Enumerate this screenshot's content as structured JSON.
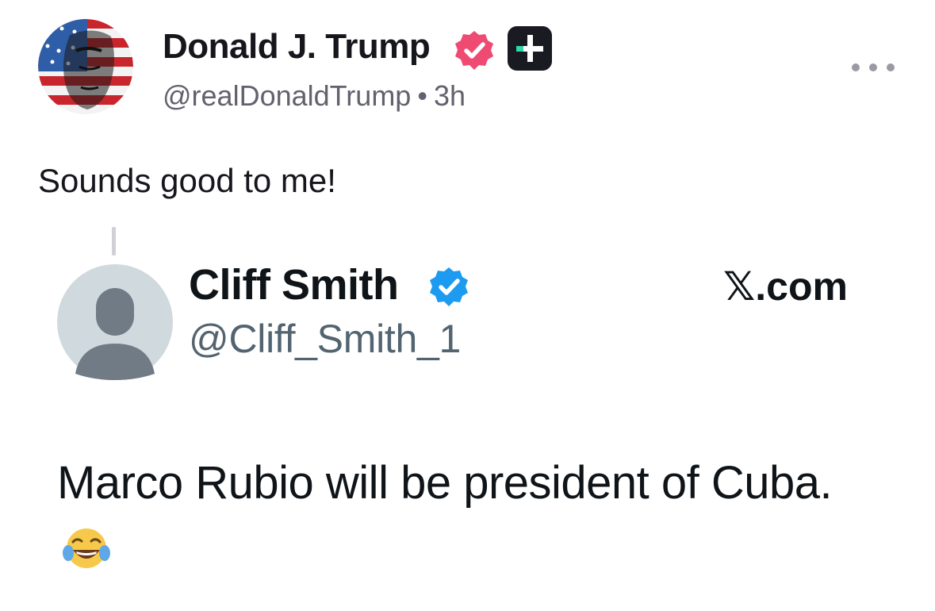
{
  "post": {
    "author": {
      "name": "Donald J. Trump",
      "handle": "@realDonaldTrump",
      "separator": "•",
      "time": "3h",
      "avatar_icon": "flag-portrait-avatar",
      "verified_icon": "verified-badge-icon",
      "plus_icon": "plus-badge-icon"
    },
    "more_icon": "ellipsis-icon",
    "text": "Sounds good to me!"
  },
  "quoted": {
    "name": "Cliff Smith",
    "handle": "@Cliff_Smith_1",
    "source": "𝕏.com",
    "text": "Marco Rubio will be president of Cuba.",
    "emoji": "face-with-tears-of-joy-icon",
    "avatar_icon": "default-profile-icon",
    "verified_icon": "blue-check-icon"
  },
  "colors": {
    "verified_pink": "#ef4a72",
    "plus_badge_bg": "#1a1a22",
    "plus_accent": "#2fd9a8",
    "x_verified_blue": "#1d9bf0",
    "muted_text": "#62626e"
  }
}
